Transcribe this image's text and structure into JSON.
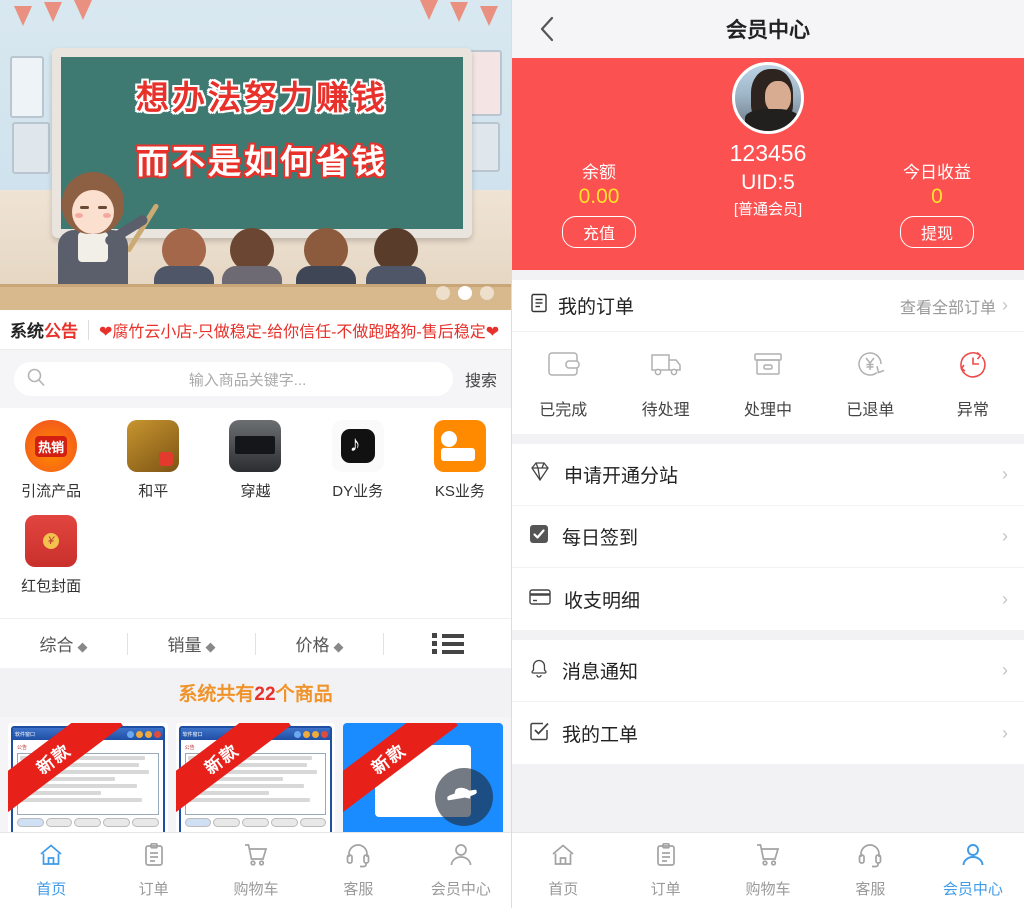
{
  "left": {
    "banner": {
      "line1": "想办法努力赚钱",
      "line2": "而不是如何省钱",
      "dots": [
        "dot-1",
        "dot-2",
        "dot-3"
      ],
      "active_dot": 1
    },
    "notice": {
      "tag_prefix": "系统",
      "tag_suffix": "公告",
      "text": "❤腐竹云小店-只做稳定-给你信任-不做跑路狗-售后稳定❤"
    },
    "search": {
      "placeholder": "输入商品关键字...",
      "value": "",
      "button": "搜索",
      "icon": "search-icon"
    },
    "categories": [
      {
        "label": "引流产品",
        "icon": "hot-sale-icon"
      },
      {
        "label": "和平",
        "icon": "peace-elite-game-icon"
      },
      {
        "label": "穿越",
        "icon": "crossfire-game-icon"
      },
      {
        "label": "DY业务",
        "icon": "douyin-icon"
      },
      {
        "label": "KS业务",
        "icon": "kuaishou-icon"
      },
      {
        "label": "红包封面",
        "icon": "red-packet-icon"
      }
    ],
    "sort": [
      {
        "label": "综合",
        "indicator": "◆"
      },
      {
        "label": "销量",
        "indicator": "◆"
      },
      {
        "label": "价格",
        "indicator": "◆"
      }
    ],
    "view_toggle_icon": "list-view-icon",
    "total": {
      "prefix": "系统共有",
      "count": "22",
      "suffix": "个商品"
    },
    "products": [
      {
        "ribbon": "新款",
        "style": "window"
      },
      {
        "ribbon": "新款",
        "style": "window"
      },
      {
        "ribbon": "新款",
        "style": "blue"
      }
    ],
    "fab": {
      "icon": "floating-action-icon"
    },
    "tabbar": [
      {
        "label": "首页",
        "icon": "home-icon",
        "active": true
      },
      {
        "label": "订单",
        "icon": "order-icon",
        "active": false
      },
      {
        "label": "购物车",
        "icon": "cart-icon",
        "active": false
      },
      {
        "label": "客服",
        "icon": "headset-icon",
        "active": false
      },
      {
        "label": "会员中心",
        "icon": "user-icon",
        "active": false
      }
    ]
  },
  "right": {
    "navbar": {
      "title": "会员中心",
      "back_icon": "chevron-left-icon"
    },
    "member": {
      "balance_label": "余额",
      "balance_value": "0.00",
      "recharge_button": "充值",
      "username": "123456",
      "uid": "UID:5",
      "level": "[普通会员]",
      "income_label": "今日收益",
      "income_value": "0",
      "withdraw_button": "提现",
      "avatar_icon": "avatar",
      "header_color": "#fb5151",
      "value_color": "#ffe12b"
    },
    "orders": {
      "title": "我的订单",
      "title_icon": "clipboard-icon",
      "view_all": "查看全部订单",
      "items": [
        {
          "label": "已完成",
          "icon": "wallet-icon"
        },
        {
          "label": "待处理",
          "icon": "truck-icon"
        },
        {
          "label": "处理中",
          "icon": "box-icon"
        },
        {
          "label": "已退单",
          "icon": "refund-yen-icon"
        },
        {
          "label": "异常",
          "icon": "clock-alert-icon",
          "color": "#ef4a4a"
        }
      ]
    },
    "menu_group_1": [
      {
        "label": "申请开通分站",
        "icon": "diamond-icon"
      },
      {
        "label": "每日签到",
        "icon": "checkbox-checked-icon"
      },
      {
        "label": "收支明细",
        "icon": "card-icon"
      }
    ],
    "menu_group_2": [
      {
        "label": "消息通知",
        "icon": "bell-icon"
      },
      {
        "label": "我的工单",
        "icon": "checkbox-outline-icon"
      }
    ],
    "tabbar": [
      {
        "label": "首页",
        "icon": "home-icon",
        "active": false
      },
      {
        "label": "订单",
        "icon": "order-icon",
        "active": false
      },
      {
        "label": "购物车",
        "icon": "cart-icon",
        "active": false
      },
      {
        "label": "客服",
        "icon": "headset-icon",
        "active": false
      },
      {
        "label": "会员中心",
        "icon": "user-icon",
        "active": true
      }
    ],
    "accent_color": "#3f9be8"
  }
}
